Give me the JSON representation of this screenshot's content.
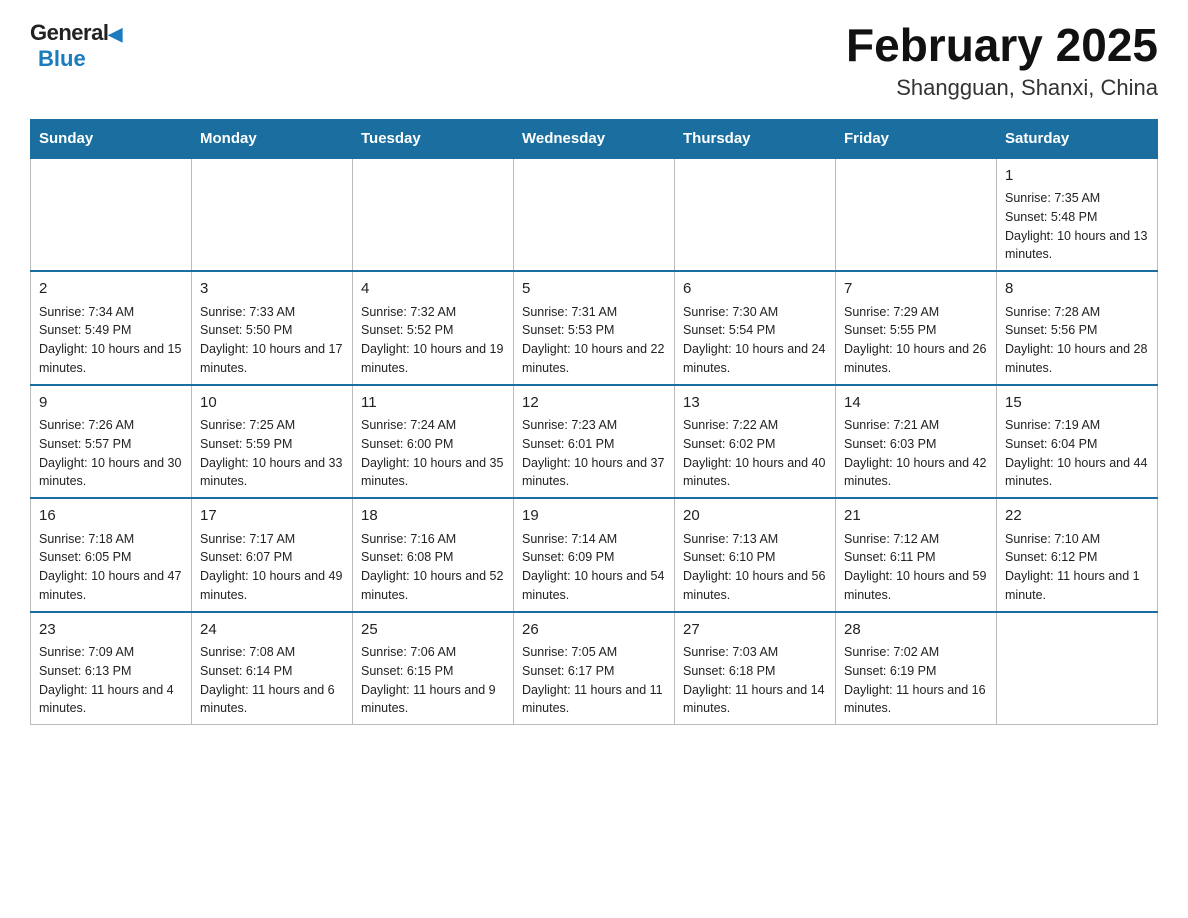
{
  "header": {
    "logo_general": "General",
    "logo_blue": "Blue",
    "title": "February 2025",
    "subtitle": "Shangguan, Shanxi, China"
  },
  "days_of_week": [
    "Sunday",
    "Monday",
    "Tuesday",
    "Wednesday",
    "Thursday",
    "Friday",
    "Saturday"
  ],
  "weeks": [
    [
      {
        "day": "",
        "info": ""
      },
      {
        "day": "",
        "info": ""
      },
      {
        "day": "",
        "info": ""
      },
      {
        "day": "",
        "info": ""
      },
      {
        "day": "",
        "info": ""
      },
      {
        "day": "",
        "info": ""
      },
      {
        "day": "1",
        "info": "Sunrise: 7:35 AM\nSunset: 5:48 PM\nDaylight: 10 hours and 13 minutes."
      }
    ],
    [
      {
        "day": "2",
        "info": "Sunrise: 7:34 AM\nSunset: 5:49 PM\nDaylight: 10 hours and 15 minutes."
      },
      {
        "day": "3",
        "info": "Sunrise: 7:33 AM\nSunset: 5:50 PM\nDaylight: 10 hours and 17 minutes."
      },
      {
        "day": "4",
        "info": "Sunrise: 7:32 AM\nSunset: 5:52 PM\nDaylight: 10 hours and 19 minutes."
      },
      {
        "day": "5",
        "info": "Sunrise: 7:31 AM\nSunset: 5:53 PM\nDaylight: 10 hours and 22 minutes."
      },
      {
        "day": "6",
        "info": "Sunrise: 7:30 AM\nSunset: 5:54 PM\nDaylight: 10 hours and 24 minutes."
      },
      {
        "day": "7",
        "info": "Sunrise: 7:29 AM\nSunset: 5:55 PM\nDaylight: 10 hours and 26 minutes."
      },
      {
        "day": "8",
        "info": "Sunrise: 7:28 AM\nSunset: 5:56 PM\nDaylight: 10 hours and 28 minutes."
      }
    ],
    [
      {
        "day": "9",
        "info": "Sunrise: 7:26 AM\nSunset: 5:57 PM\nDaylight: 10 hours and 30 minutes."
      },
      {
        "day": "10",
        "info": "Sunrise: 7:25 AM\nSunset: 5:59 PM\nDaylight: 10 hours and 33 minutes."
      },
      {
        "day": "11",
        "info": "Sunrise: 7:24 AM\nSunset: 6:00 PM\nDaylight: 10 hours and 35 minutes."
      },
      {
        "day": "12",
        "info": "Sunrise: 7:23 AM\nSunset: 6:01 PM\nDaylight: 10 hours and 37 minutes."
      },
      {
        "day": "13",
        "info": "Sunrise: 7:22 AM\nSunset: 6:02 PM\nDaylight: 10 hours and 40 minutes."
      },
      {
        "day": "14",
        "info": "Sunrise: 7:21 AM\nSunset: 6:03 PM\nDaylight: 10 hours and 42 minutes."
      },
      {
        "day": "15",
        "info": "Sunrise: 7:19 AM\nSunset: 6:04 PM\nDaylight: 10 hours and 44 minutes."
      }
    ],
    [
      {
        "day": "16",
        "info": "Sunrise: 7:18 AM\nSunset: 6:05 PM\nDaylight: 10 hours and 47 minutes."
      },
      {
        "day": "17",
        "info": "Sunrise: 7:17 AM\nSunset: 6:07 PM\nDaylight: 10 hours and 49 minutes."
      },
      {
        "day": "18",
        "info": "Sunrise: 7:16 AM\nSunset: 6:08 PM\nDaylight: 10 hours and 52 minutes."
      },
      {
        "day": "19",
        "info": "Sunrise: 7:14 AM\nSunset: 6:09 PM\nDaylight: 10 hours and 54 minutes."
      },
      {
        "day": "20",
        "info": "Sunrise: 7:13 AM\nSunset: 6:10 PM\nDaylight: 10 hours and 56 minutes."
      },
      {
        "day": "21",
        "info": "Sunrise: 7:12 AM\nSunset: 6:11 PM\nDaylight: 10 hours and 59 minutes."
      },
      {
        "day": "22",
        "info": "Sunrise: 7:10 AM\nSunset: 6:12 PM\nDaylight: 11 hours and 1 minute."
      }
    ],
    [
      {
        "day": "23",
        "info": "Sunrise: 7:09 AM\nSunset: 6:13 PM\nDaylight: 11 hours and 4 minutes."
      },
      {
        "day": "24",
        "info": "Sunrise: 7:08 AM\nSunset: 6:14 PM\nDaylight: 11 hours and 6 minutes."
      },
      {
        "day": "25",
        "info": "Sunrise: 7:06 AM\nSunset: 6:15 PM\nDaylight: 11 hours and 9 minutes."
      },
      {
        "day": "26",
        "info": "Sunrise: 7:05 AM\nSunset: 6:17 PM\nDaylight: 11 hours and 11 minutes."
      },
      {
        "day": "27",
        "info": "Sunrise: 7:03 AM\nSunset: 6:18 PM\nDaylight: 11 hours and 14 minutes."
      },
      {
        "day": "28",
        "info": "Sunrise: 7:02 AM\nSunset: 6:19 PM\nDaylight: 11 hours and 16 minutes."
      },
      {
        "day": "",
        "info": ""
      }
    ]
  ]
}
